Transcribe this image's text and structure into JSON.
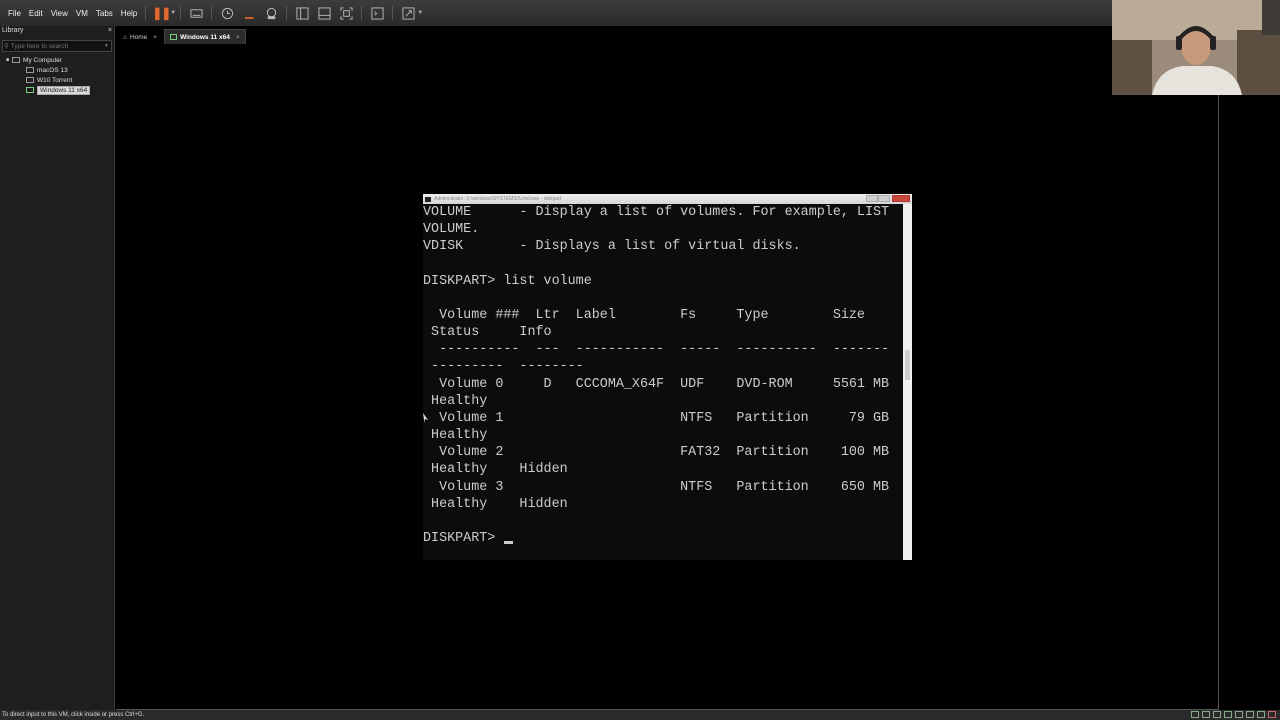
{
  "menu": [
    "File",
    "Edit",
    "View",
    "VM",
    "Tabs",
    "Help"
  ],
  "library": {
    "title": "Library",
    "close": "×",
    "search_placeholder": "Type here to search",
    "tree": [
      {
        "label": "My Computer",
        "level": 0
      },
      {
        "label": "macOS 13",
        "level": 1
      },
      {
        "label": "W10 Torrent",
        "level": 1
      },
      {
        "label": "Windows 11 x64",
        "level": 1,
        "selected": true
      }
    ]
  },
  "tabs": [
    {
      "label": "Home",
      "close": "×",
      "active": false
    },
    {
      "label": "Windows 11 x64",
      "close": "×",
      "active": true
    }
  ],
  "cmd": {
    "title": "Administrator: X:\\windows\\SYSTEM32\\cmd.exe - diskpart",
    "lines": [
      "VOLUME      - Display a list of volumes. For example, LIST",
      "VOLUME.",
      "VDISK       - Displays a list of virtual disks.",
      "",
      "DISKPART> list volume",
      "",
      "  Volume ###  Ltr  Label        Fs     Type        Size",
      " Status     Info",
      "  ----------  ---  -----------  -----  ----------  -------",
      " ---------  --------",
      "  Volume 0     D   CCCOMA_X64F  UDF    DVD-ROM     5561 MB",
      " Healthy",
      "  Volume 1                      NTFS   Partition     79 GB",
      " Healthy",
      "  Volume 2                      FAT32  Partition    100 MB",
      " Healthy    Hidden",
      "  Volume 3                      NTFS   Partition    650 MB",
      " Healthy    Hidden",
      ""
    ],
    "prompt": "DISKPART> "
  },
  "status": {
    "hint": "To direct input to this VM, click inside or press Ctrl+G."
  },
  "colors": {
    "pause_accent": "#e0672d",
    "console_text": "#cccccc",
    "console_bg": "#0c0c0c"
  }
}
